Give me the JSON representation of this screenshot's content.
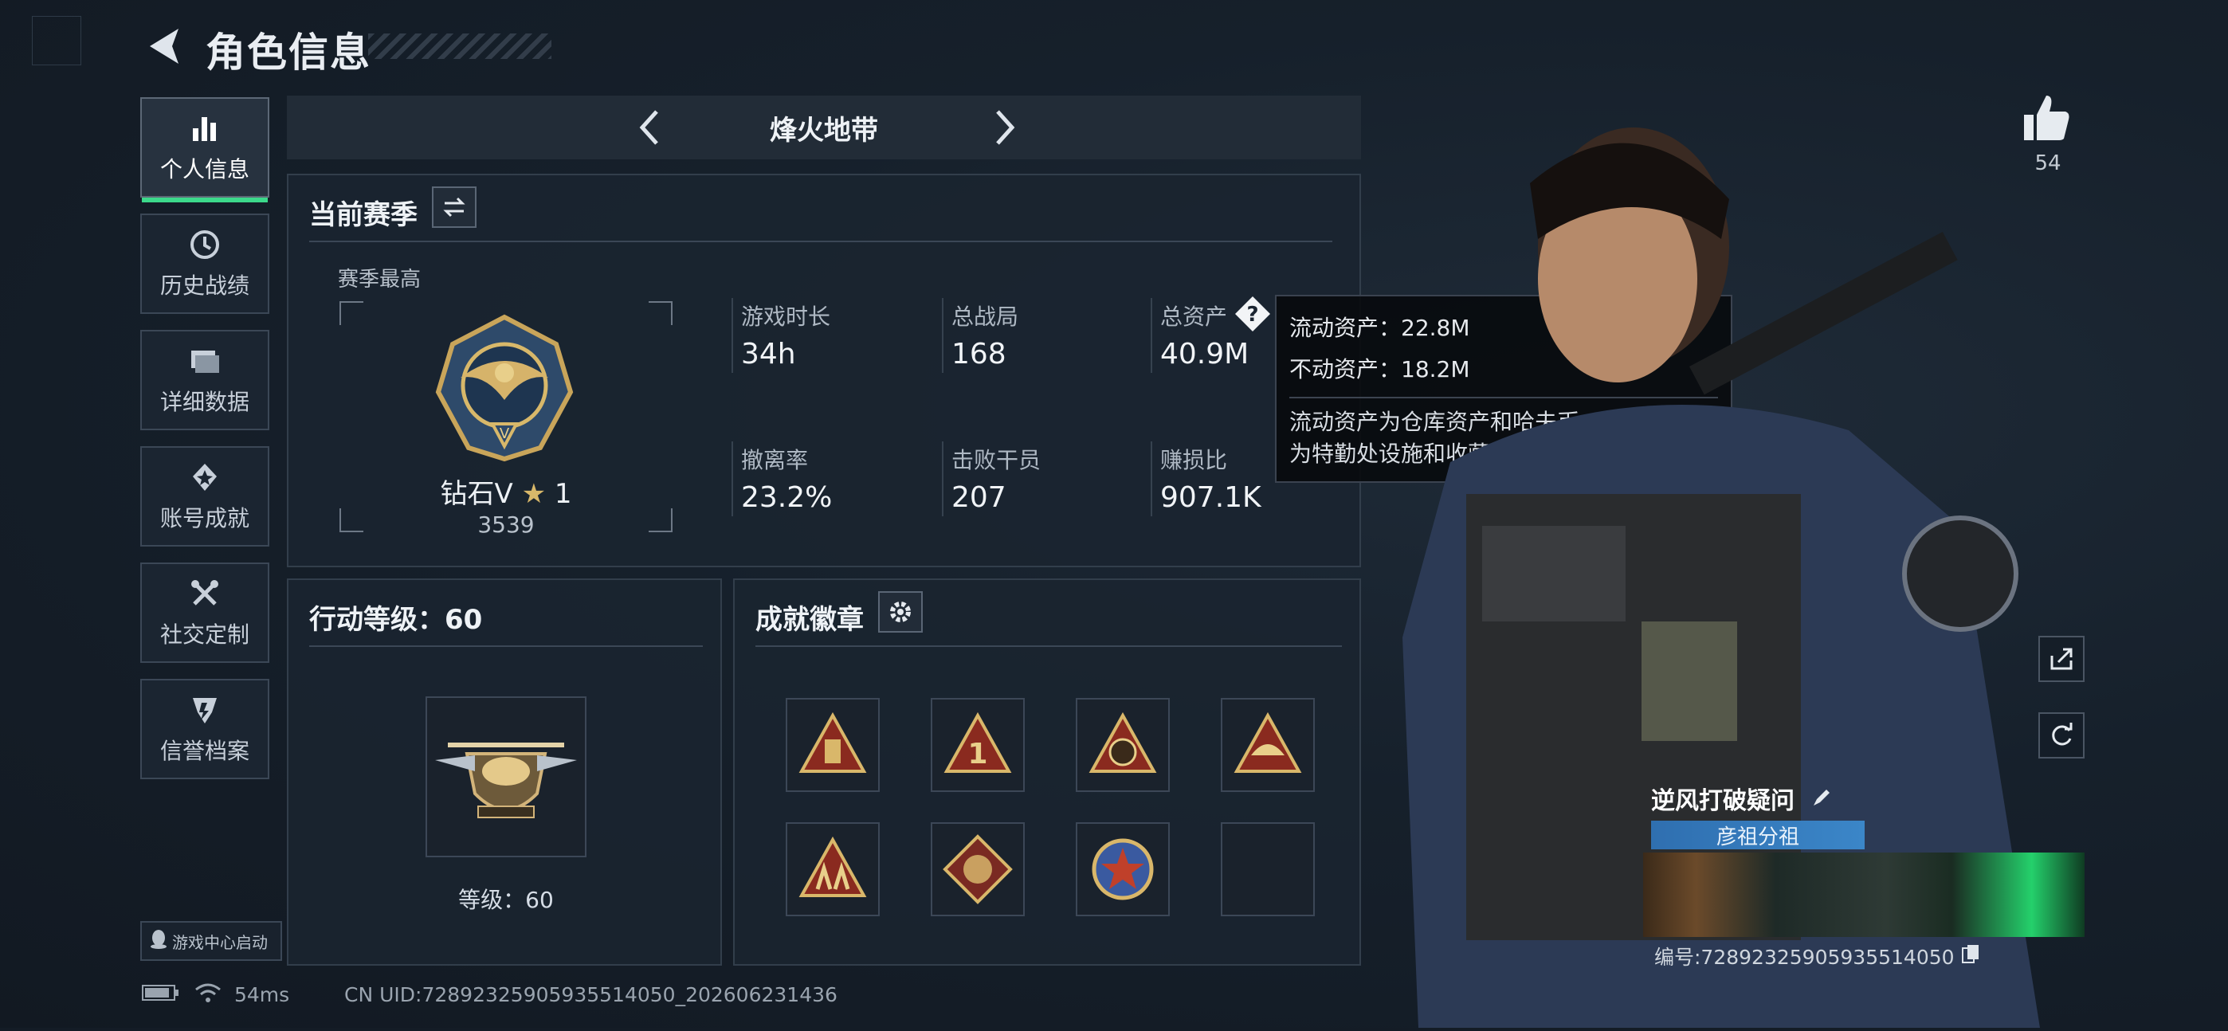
{
  "header": {
    "title": "角色信息"
  },
  "sidebar": {
    "items": [
      {
        "label": "个人信息",
        "icon": "bar-chart-icon",
        "active": true
      },
      {
        "label": "历史战绩",
        "icon": "history-icon"
      },
      {
        "label": "详细数据",
        "icon": "folder-icon"
      },
      {
        "label": "账号成就",
        "icon": "achievement-icon"
      },
      {
        "label": "社交定制",
        "icon": "tools-icon"
      },
      {
        "label": "信誉档案",
        "icon": "reputation-icon"
      }
    ],
    "game_center": "游戏中心启动"
  },
  "mode_bar": {
    "title": "烽火地带"
  },
  "season": {
    "title": "当前赛季",
    "best_label": "赛季最高",
    "rank_name": "钻石V",
    "rank_stars": "1",
    "rank_score": "3539",
    "stats": [
      {
        "label": "游戏时长",
        "value": "34h"
      },
      {
        "label": "总战局",
        "value": "168"
      },
      {
        "label": "总资产",
        "value": "40.9M"
      },
      {
        "label": "撤离率",
        "value": "23.2%"
      },
      {
        "label": "击败干员",
        "value": "207"
      },
      {
        "label": "赚损比",
        "value": "907.1K"
      }
    ]
  },
  "tooltip": {
    "liquid": "流动资产：22.8M",
    "fixed": "不动资产：18.2M",
    "desc_line1": "流动资产为仓库资产和哈夫币，不动资产",
    "desc_line2": "为特勤处设施和收藏室设施"
  },
  "action_level": {
    "title": "行动等级：60",
    "level_label": "等级：60"
  },
  "badges": {
    "title": "成就徽章"
  },
  "profile": {
    "likes": "54",
    "player_name": "逆风打破疑问",
    "group_tag": "彦祖分祖",
    "id_number": "编号:7289232590593551405​0"
  },
  "status_bar": {
    "ping": "54ms",
    "uid": "CN UID:7289232590593551405​0_202606231436"
  },
  "colors": {
    "accent": "#3cd98b",
    "panel": "#1a2430"
  }
}
